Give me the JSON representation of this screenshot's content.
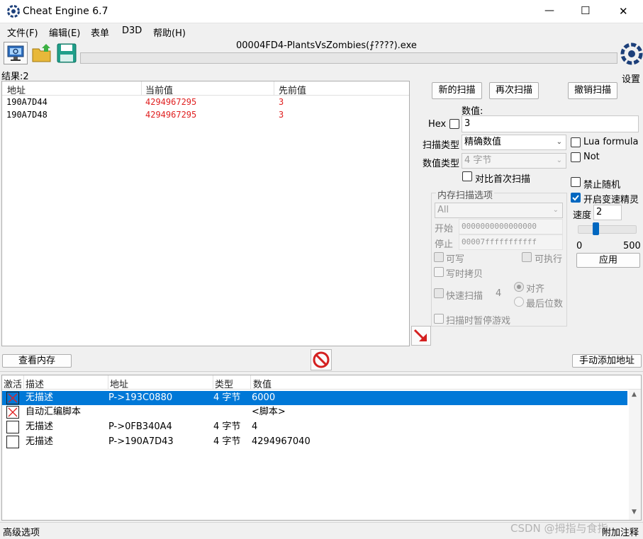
{
  "window": {
    "title": "Cheat Engine 6.7",
    "process": "00004FD4-PlantsVsZombies(⨍????).exe",
    "minimize": "—",
    "maximize": "☐",
    "close": "✕"
  },
  "menu": [
    "文件(F)",
    "编辑(E)",
    "表单",
    "D3D",
    "帮助(H)"
  ],
  "settings_label": "设置",
  "results_label": "结果:2",
  "found_list": {
    "headers": [
      "地址",
      "当前值",
      "先前值"
    ],
    "rows": [
      {
        "address": "190A7D44",
        "current": "4294967295",
        "previous": "3"
      },
      {
        "address": "190A7D48",
        "current": "4294967295",
        "previous": "3"
      }
    ]
  },
  "scan": {
    "new_scan": "新的扫描",
    "next_scan": "再次扫描",
    "undo_scan": "撤销扫描",
    "value_label": "数值:",
    "hex_label": "Hex",
    "value": "3",
    "scan_type_label": "扫描类型",
    "scan_type": "精确数值",
    "value_type_label": "数值类型",
    "value_type": "4 字节",
    "compare_first": "对比首次扫描",
    "lua_formula": "Lua formula",
    "not": "Not",
    "mem_options_title": "内存扫描选项",
    "region": "All",
    "start_label": "开始",
    "start_value": "0000000000000000",
    "stop_label": "停止",
    "stop_value": "00007fffffffffff",
    "writable": "可写",
    "executable": "可执行",
    "copy_on_write": "写时拷贝",
    "fast_scan": "快速扫描",
    "fast_scan_value": "4",
    "align": "对齐",
    "last_digits": "最后位数",
    "pause_game": "扫描时暂停游戏",
    "disable_random": "禁止随机",
    "speedhack": "开启变速精灵",
    "speed_label": "速度",
    "speed_value": "2",
    "slider_min": "0",
    "slider_max": "500",
    "slider_level": 0.004,
    "apply": "应用"
  },
  "view_memory": "查看内存",
  "add_address_manually": "手动添加地址",
  "address_list": {
    "headers": [
      "激活",
      "描述",
      "地址",
      "类型",
      "数值"
    ],
    "rows": [
      {
        "active": "x",
        "description": "无描述",
        "address": "P->193C0880",
        "type": "4 字节",
        "value": "6000",
        "selected": true
      },
      {
        "active": "x",
        "description": "自动汇编脚本",
        "address": "",
        "type": "",
        "value": "<脚本>",
        "selected": false
      },
      {
        "active": "",
        "description": "无描述",
        "address": "P->0FB340A4",
        "type": "4 字节",
        "value": "4",
        "selected": false
      },
      {
        "active": "",
        "description": "无描述",
        "address": "P->190A7D43",
        "type": "4 字节",
        "value": "4294967040",
        "selected": false
      }
    ]
  },
  "status": {
    "advanced": "高级选项",
    "watermark": "CSDN @拇指与食指",
    "add_comment": "附加注释"
  },
  "colors": {
    "red_value": "#e02020",
    "selection": "#0078d7"
  }
}
